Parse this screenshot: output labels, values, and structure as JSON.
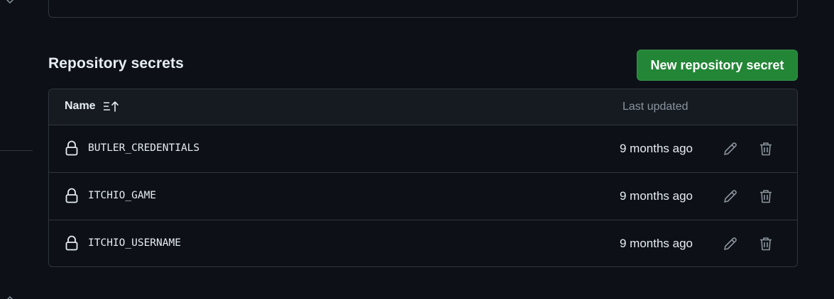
{
  "section": {
    "title": "Repository secrets",
    "new_button_label": "New repository secret"
  },
  "table": {
    "columns": {
      "name": "Name",
      "last_updated": "Last updated"
    },
    "rows": [
      {
        "name": "BUTLER_CREDENTIALS",
        "updated": "9 months ago"
      },
      {
        "name": "ITCHIO_GAME",
        "updated": "9 months ago"
      },
      {
        "name": "ITCHIO_USERNAME",
        "updated": "9 months ago"
      }
    ]
  },
  "icons": {
    "lock": "lock-icon",
    "edit": "pencil-icon",
    "delete": "trash-icon",
    "sort": "sort-ascending-icon",
    "sidebar_chevron": "chevron-down-icon"
  },
  "colors": {
    "background": "#0d1117",
    "header_bg": "#161b22",
    "border": "#30363d",
    "button_green": "#238636",
    "text": "#e6edf3",
    "muted": "#8b949e"
  }
}
